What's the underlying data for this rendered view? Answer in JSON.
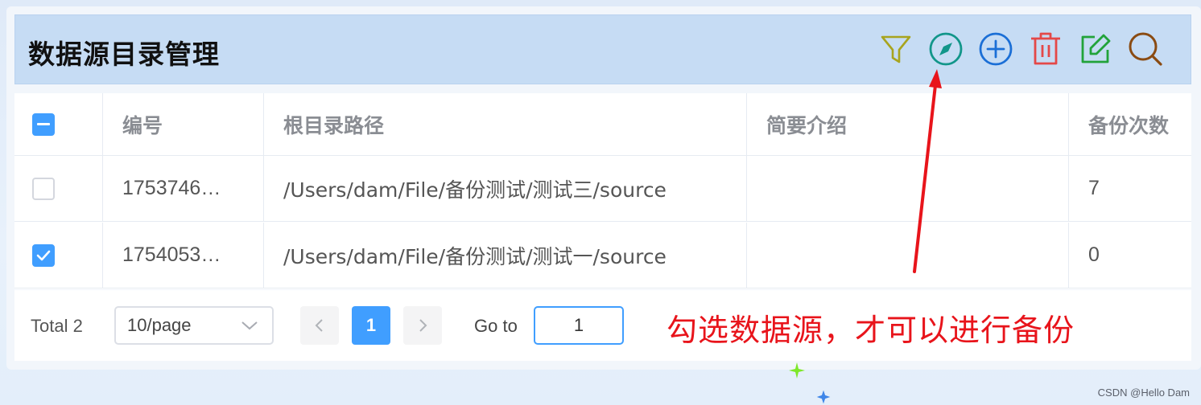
{
  "header": {
    "title": "数据源目录管理",
    "toolbar": [
      {
        "icon": "filter-icon",
        "color": "#a8a41e"
      },
      {
        "icon": "compass-icon",
        "color": "#12968a"
      },
      {
        "icon": "plus-circle-icon",
        "color": "#1b6fd6"
      },
      {
        "icon": "trash-icon",
        "color": "#e44848"
      },
      {
        "icon": "edit-icon",
        "color": "#22a33a"
      },
      {
        "icon": "search-icon",
        "color": "#8a4b12"
      }
    ]
  },
  "table": {
    "columns": [
      "编号",
      "根目录路径",
      "简要介绍",
      "备份次数"
    ],
    "rows": [
      {
        "checked": false,
        "id": "1753746…",
        "path": "/Users/dam/File/备份测试/测试三/source",
        "desc": "",
        "backup_count": "7"
      },
      {
        "checked": true,
        "id": "1754053…",
        "path": "/Users/dam/File/备份测试/测试一/source",
        "desc": "",
        "backup_count": "0"
      }
    ]
  },
  "pagination": {
    "total": "Total 2",
    "page_size": "10/page",
    "current_page": "1",
    "goto_label": "Go to",
    "goto_value": "1"
  },
  "annotation": {
    "text": "勾选数据源，才可以进行备份",
    "color": "#e8141b"
  },
  "watermark": "CSDN @Hello Dam",
  "colors": {
    "accent": "#409eff",
    "header_bg": "#c6dcf4"
  }
}
